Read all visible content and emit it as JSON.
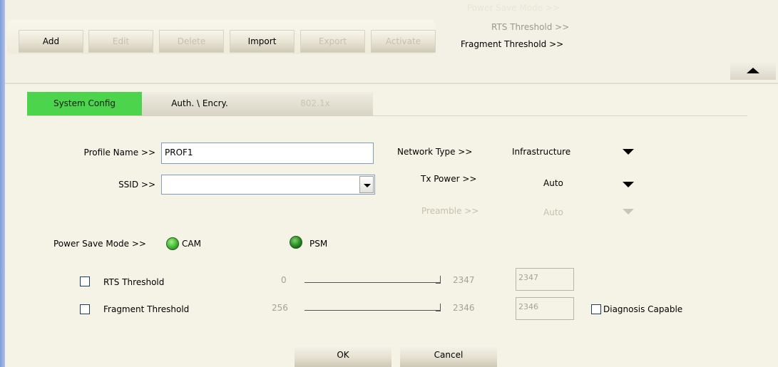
{
  "toolbar": {
    "add": "Add",
    "edit": "Edit",
    "delete": "Delete",
    "import": "Import",
    "export": "Export",
    "activate": "Activate"
  },
  "advanced_links": {
    "ghost": "Power Save Mode >>",
    "rts": "RTS Threshold >>",
    "fragment": "Fragment Threshold >>"
  },
  "collapse_icon": "triangle-up-icon",
  "tabs": [
    {
      "label": "System Config",
      "state": "active"
    },
    {
      "label": "Auth. \\ Encry.",
      "state": "normal"
    },
    {
      "label": "802.1x",
      "state": "disabled"
    }
  ],
  "form": {
    "profile_name_label": "Profile Name >>",
    "profile_name_value": "PROF1",
    "ssid_label": "SSID >>",
    "ssid_value": "",
    "network_type_label": "Network Type >>",
    "network_type_value": "Infrastructure",
    "tx_power_label": "Tx Power >>",
    "tx_power_value": "Auto",
    "preamble_label": "Preamble >>",
    "preamble_value": "Auto",
    "power_save_label": "Power Save Mode >>",
    "cam_label": "CAM",
    "psm_label": "PSM",
    "power_save_selected": "CAM",
    "rts": {
      "label": "RTS Threshold",
      "min": "0",
      "max": "2347",
      "value": "2347",
      "checked": false
    },
    "fragment": {
      "label": "Fragment Threshold",
      "min": "256",
      "max": "2346",
      "value": "2346",
      "checked": false
    },
    "diagnosis_label": "Diagnosis Capable"
  },
  "buttons": {
    "ok": "OK",
    "cancel": "Cancel"
  },
  "colors": {
    "active_tab": "#4cd44c",
    "background": "#f5f2e6",
    "disabled_text": "#c6c0ad"
  }
}
